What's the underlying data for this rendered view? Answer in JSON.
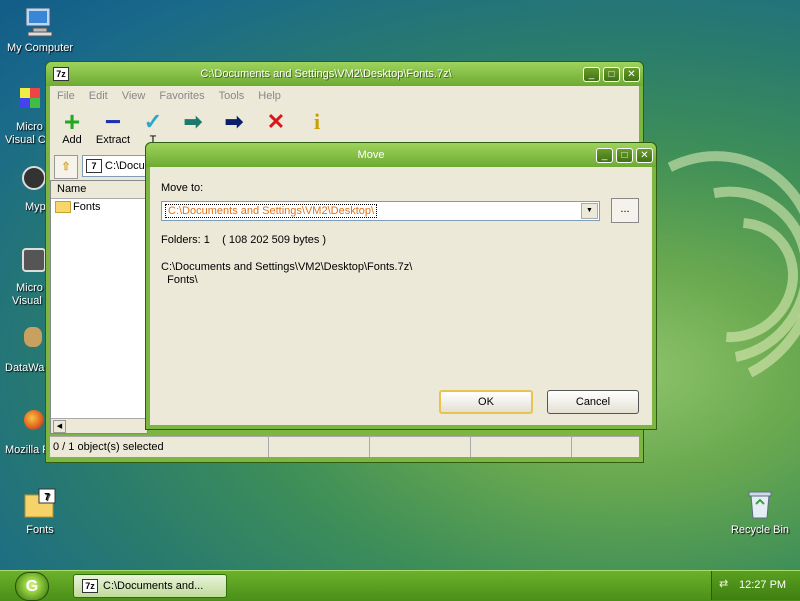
{
  "desktop": {
    "icons": [
      {
        "label": "My Computer"
      },
      {
        "label": "Fonts"
      },
      {
        "label": "Recycle Bin"
      }
    ],
    "partial_labels": [
      "Micro",
      "Visual C",
      "Myp",
      "Micro",
      "Visual",
      "DataWa",
      "Mozilla F"
    ]
  },
  "main_window": {
    "title": "C:\\Documents and Settings\\VM2\\Desktop\\Fonts.7z\\",
    "menu": [
      "File",
      "Edit",
      "View",
      "Favorites",
      "Tools",
      "Help"
    ],
    "toolbar": [
      {
        "label": "Add",
        "icon": "plus-icon"
      },
      {
        "label": "Extract",
        "icon": "minus-icon"
      },
      {
        "label": "T",
        "icon": "check-icon"
      }
    ],
    "address": "C:\\Docum",
    "column_name": "Name",
    "files": [
      {
        "name": "Fonts"
      }
    ],
    "status": "0 / 1 object(s) selected"
  },
  "dialog": {
    "title": "Move",
    "move_to_label": "Move to:",
    "path_value": "C:\\Documents and Settings\\VM2\\Desktop\\",
    "browse_label": "...",
    "folders_line": "Folders: 1    ( 108 202 509 bytes )",
    "source_path": "C:\\Documents and Settings\\VM2\\Desktop\\Fonts.7z\\",
    "source_folder": "  Fonts\\",
    "ok_label": "OK",
    "cancel_label": "Cancel"
  },
  "taskbar": {
    "task_label": "C:\\Documents and...",
    "clock": "12:27 PM"
  },
  "colors": {
    "window_frame": "#7db542",
    "title_green": "#9ed35c",
    "path_text": "#e0731a"
  }
}
